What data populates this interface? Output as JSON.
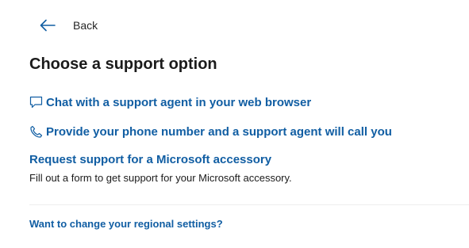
{
  "nav": {
    "back_label": "Back"
  },
  "page": {
    "title": "Choose a support option"
  },
  "options": {
    "chat_label": "Chat with a support agent in your web browser",
    "phone_label": "Provide your phone number and a support agent will call you",
    "accessory_label": "Request support for a Microsoft accessory",
    "accessory_description": "Fill out a form to get support for your Microsoft accessory."
  },
  "footer": {
    "regional_link": "Want to change your regional settings?"
  },
  "icons": {
    "back": "arrow-left-icon",
    "chat": "chat-bubble-icon",
    "phone": "phone-icon"
  },
  "colors": {
    "link": "#115ea3",
    "text": "#1b1b1b",
    "divider": "#ededed"
  }
}
